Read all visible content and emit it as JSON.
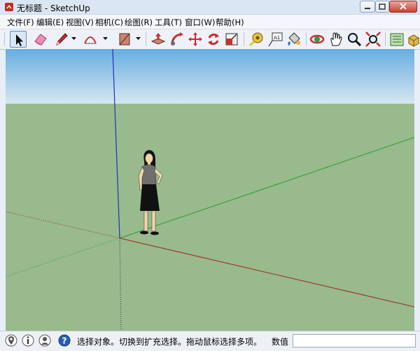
{
  "window": {
    "title": "无标题 - SketchUp",
    "app_icon": "sketchup-logo-icon"
  },
  "menu": [
    {
      "id": "file",
      "label": "文件(F)"
    },
    {
      "id": "edit",
      "label": "编辑(E)"
    },
    {
      "id": "view",
      "label": "视图(V)"
    },
    {
      "id": "camera",
      "label": "相机(C)"
    },
    {
      "id": "draw",
      "label": "绘图(R)"
    },
    {
      "id": "tools",
      "label": "工具(T)"
    },
    {
      "id": "window",
      "label": "窗口(W)"
    },
    {
      "id": "help",
      "label": "帮助(H)"
    }
  ],
  "toolbar": {
    "tools": [
      "select-arrow-icon",
      "eraser-icon",
      "pencil-line-icon",
      "arc-icon",
      "rectangle-icon",
      "push-pull-icon",
      "follow-me-icon",
      "move-icon",
      "rotate-icon",
      "scale-icon",
      "tape-measure-icon",
      "text-label-icon",
      "paint-bucket-icon",
      "orbit-icon",
      "pan-hand-icon",
      "zoom-magnifier-icon",
      "zoom-extents-icon",
      "warehouse-icon"
    ],
    "active_tool": "select-arrow-icon"
  },
  "viewport": {
    "sky_top": "#66aee0",
    "sky_bottom": "#d7e6f1",
    "ground": "#98ba8d",
    "axis_colors": {
      "red": "#9c2c18",
      "green": "#2a9e2a",
      "blue": "#2032b8"
    },
    "figure": "scale-figure-woman"
  },
  "status": {
    "icons": [
      "geolocation-icon",
      "credits-icon",
      "user-icon",
      "help-icon"
    ],
    "text": "选择对象。切换到扩充选择。拖动鼠标选择多项。",
    "measurements_label": "数值"
  }
}
